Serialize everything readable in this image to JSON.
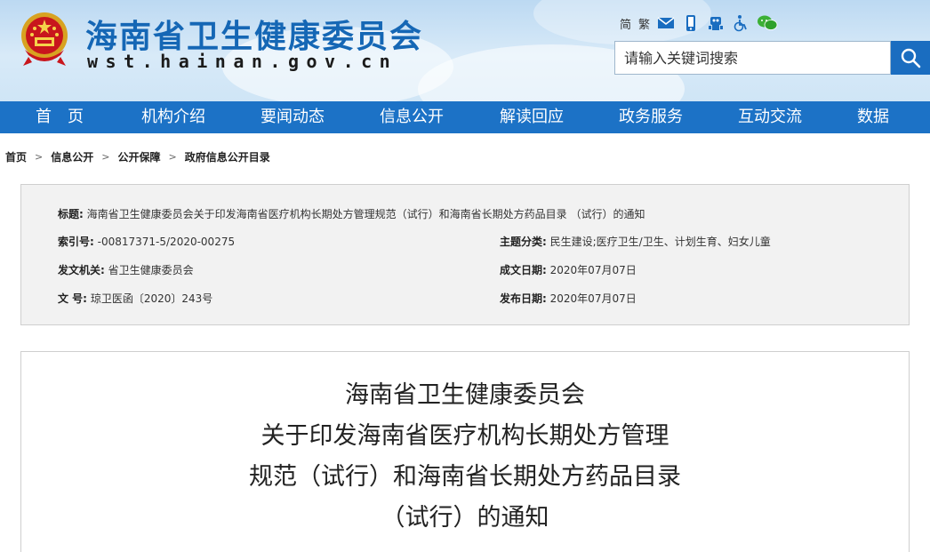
{
  "header": {
    "site_title": "海南省卫生健康委员会",
    "site_url": "wst.hainan.gov.cn",
    "tools": {
      "simplified": "简",
      "traditional": "繁",
      "icons": [
        "mail-icon",
        "mobile-icon",
        "robot-icon",
        "wheelchair-icon",
        "wechat-icon"
      ]
    },
    "search_placeholder": "请输入关键词搜索"
  },
  "nav": {
    "items": [
      "首　页",
      "机构介绍",
      "要闻动态",
      "信息公开",
      "解读回应",
      "政务服务",
      "互动交流",
      "数据"
    ]
  },
  "breadcrumb": [
    "首页",
    "信息公开",
    "公开保障",
    "政府信息公开目录"
  ],
  "info": {
    "title_label": "标题:",
    "title_value": "海南省卫生健康委员会关于印发海南省医疗机构长期处方管理规范（试行）和海南省长期处方药品目录 （试行）的通知",
    "index_label": "索引号:",
    "index_value": "-00817371-5/2020-00275",
    "category_label": "主题分类:",
    "category_value": "民生建设;医疗卫生/卫生、计划生育、妇女儿童",
    "issuer_label": "发文机关:",
    "issuer_value": "省卫生健康委员会",
    "created_label": "成文日期:",
    "created_value": "2020年07月07日",
    "docno_label": "文 号:",
    "docno_value": "琼卫医函〔2020〕243号",
    "published_label": "发布日期:",
    "published_value": "2020年07月07日"
  },
  "article": {
    "title_lines": [
      "海南省卫生健康委员会",
      "关于印发海南省医疗机构长期处方管理",
      "规范（试行）和海南省长期处方药品目录",
      "（试行）的通知"
    ]
  },
  "colors": {
    "brand_blue": "#1c72c6",
    "title_blue": "#1567b5",
    "search_button": "#1a6dc0"
  }
}
